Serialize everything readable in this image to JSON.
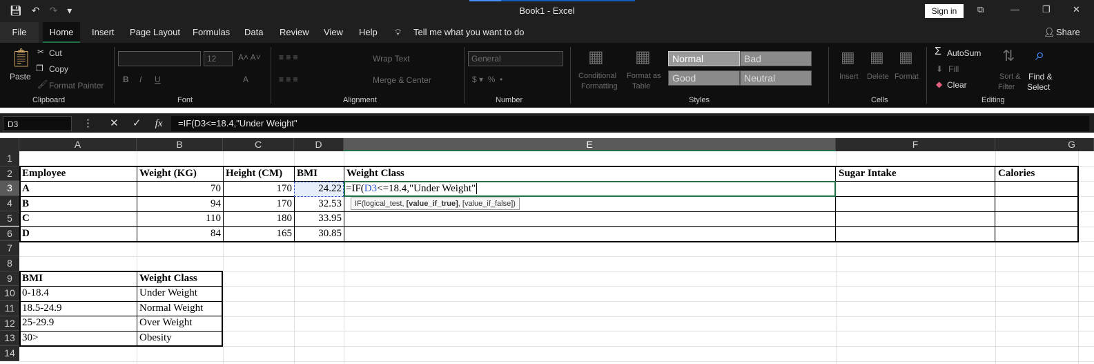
{
  "window": {
    "title": "Book1 - Excel",
    "signin": "Sign in",
    "share": "Share"
  },
  "menu": {
    "tabs": [
      "File",
      "Home",
      "Insert",
      "Page Layout",
      "Formulas",
      "Data",
      "Review",
      "View",
      "Help"
    ],
    "tell_me": "Tell me what you want to do"
  },
  "ribbon": {
    "clipboard": {
      "paste": "Paste",
      "cut": "Cut",
      "copy": "Copy",
      "format_painter": "Format Painter",
      "label": "Clipboard"
    },
    "font": {
      "label": "Font",
      "size": "12"
    },
    "alignment": {
      "wrap_text": "Wrap Text",
      "merge_center": "Merge & Center",
      "label": "Alignment"
    },
    "number": {
      "format": "General",
      "label": "Number"
    },
    "styles": {
      "conditional": "Conditional",
      "formatting": "Formatting",
      "format_as": "Format as",
      "table": "Table",
      "normal": "Normal",
      "bad": "Bad",
      "good": "Good",
      "neutral": "Neutral",
      "label": "Styles"
    },
    "cells": {
      "insert": "Insert",
      "delete": "Delete",
      "format": "Format",
      "label": "Cells"
    },
    "editing": {
      "autosum": "AutoSum",
      "fill": "Fill",
      "clear": "Clear",
      "sort": "Sort &",
      "filter": "Filter",
      "find": "Find &",
      "select": "Select",
      "label": "Editing"
    }
  },
  "formula_bar": {
    "name_box": "D3",
    "formula": "=IF(D3<=18.4,\"Under Weight\""
  },
  "columns": [
    "A",
    "B",
    "C",
    "D",
    "E",
    "F",
    "G"
  ],
  "rows": [
    "1",
    "2",
    "3",
    "4",
    "5",
    "6",
    "7",
    "8",
    "9",
    "10",
    "11",
    "12",
    "13",
    "14"
  ],
  "table1": {
    "headers": [
      "Employee",
      "Weight (KG)",
      "Height (CM)",
      "BMI",
      "Weight Class",
      "Sugar Intake",
      "Calories"
    ],
    "rows": [
      {
        "name": "A",
        "weight": "70",
        "height": "170",
        "bmi": "24.22"
      },
      {
        "name": "B",
        "weight": "94",
        "height": "170",
        "bmi": "32.53"
      },
      {
        "name": "C",
        "weight": "110",
        "height": "180",
        "bmi": "33.95"
      },
      {
        "name": "D",
        "weight": "84",
        "height": "165",
        "bmi": "30.85"
      }
    ]
  },
  "table2": {
    "headers": [
      "BMI",
      "Weight Class"
    ],
    "rows": [
      [
        "0-18.4",
        "Under Weight"
      ],
      [
        "18.5-24.9",
        "Normal Weight"
      ],
      [
        "25-29.9",
        "Over Weight"
      ],
      [
        "30>",
        "Obesity"
      ]
    ]
  },
  "edit": {
    "prefix": "=IF(",
    "ref": "D3",
    "rest": "<=18.4,\"Under Weight\""
  },
  "tooltip": {
    "fn": "IF(logical_test, ",
    "bold": "[value_if_true]",
    "rest": ", [value_if_false])"
  }
}
